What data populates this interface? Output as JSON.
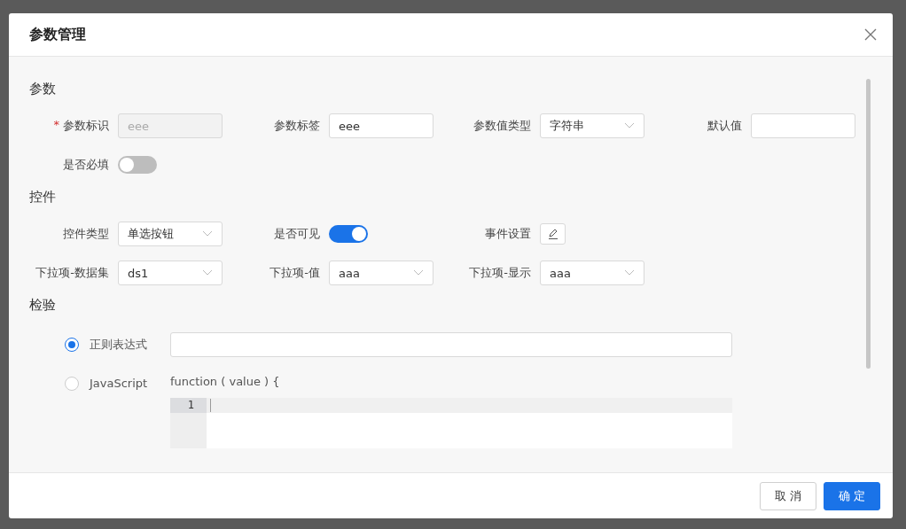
{
  "dialog": {
    "title": "参数管理"
  },
  "sections": [
    {
      "title": "参数",
      "rows": [
        [
          {
            "kind": "input",
            "label": "参数标识",
            "required_mark": "*",
            "value": "eee",
            "disabled": true
          },
          {
            "kind": "input",
            "label": "参数标签",
            "value": "eee",
            "disabled": false
          },
          {
            "kind": "select",
            "label": "参数值类型",
            "value": "字符串"
          },
          {
            "kind": "input",
            "label": "默认值",
            "disabled": false
          }
        ],
        [
          {
            "kind": "switch",
            "label": "是否必填",
            "on": false
          }
        ]
      ]
    },
    {
      "title": "控件",
      "rows": [
        [
          {
            "kind": "select",
            "label": "控件类型",
            "value": "单选按钮"
          },
          {
            "kind": "switch",
            "label": "是否可见",
            "on": true
          },
          {
            "kind": "edit",
            "label": "事件设置"
          }
        ],
        [
          {
            "kind": "select",
            "label": "下拉项-数据集",
            "value": "ds1"
          },
          {
            "kind": "select",
            "label": "下拉项-值",
            "value": "aaa"
          },
          {
            "kind": "select",
            "label": "下拉项-显示",
            "value": "aaa"
          }
        ]
      ]
    }
  ],
  "validation": {
    "title": "检验",
    "options": [
      {
        "kind": "regex",
        "label": "正则表达式",
        "selected": true
      },
      {
        "kind": "script",
        "label": "JavaScript",
        "selected": false,
        "header": "function ( value ) {",
        "line_numbers": [
          "1"
        ]
      }
    ]
  },
  "buttons": [
    {
      "label": "取 消",
      "kind": "default"
    },
    {
      "label": "确 定",
      "kind": "primary"
    }
  ]
}
